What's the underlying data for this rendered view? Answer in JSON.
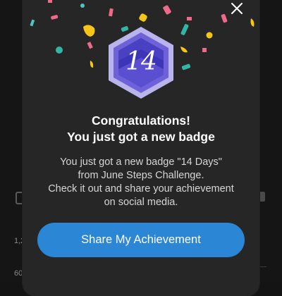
{
  "background": {
    "left_value_1": "1,2",
    "left_value_2": "60"
  },
  "modal": {
    "close_icon": "close-icon",
    "badge": {
      "label": "14",
      "colors": {
        "outer": "#b9b4ec",
        "rim": "#6f62d8",
        "face": "#3d35b8",
        "band": "#5a4fd0"
      }
    },
    "title_line1": "Congratulations!",
    "title_line2": "You just got a new badge",
    "desc_line1": "You just got a new badge \"14 Days\"",
    "desc_line2": "from June Steps Challenge.",
    "desc_line3": "Check it out and share your achievement",
    "desc_line4": "on social media.",
    "share_button_label": "Share My Achievement",
    "accent_color": "#2b86d6"
  }
}
